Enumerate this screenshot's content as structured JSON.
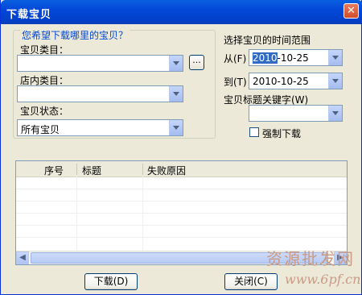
{
  "window": {
    "title": "下载宝贝"
  },
  "filter_group": {
    "legend": "您希望下载哪里的宝贝？",
    "category_label": "宝贝类目：",
    "category_value": "",
    "browse_label": "...",
    "shop_category_label": "店内类目：",
    "shop_category_value": "",
    "status_label": "宝贝状态：",
    "status_value": "所有宝贝"
  },
  "time_range": {
    "label": "选择宝贝的时间范围",
    "from_label": "从(F)",
    "from_year": "2010",
    "from_rest": "-10-25",
    "to_label": "到(T)",
    "to_value": "2010-10-25"
  },
  "keyword": {
    "label": "宝贝标题关键字(W)",
    "value": ""
  },
  "force_download": {
    "label": "强制下载",
    "checked": false
  },
  "results_table": {
    "columns": [
      "序号",
      "标题",
      "失败原因"
    ],
    "rows": []
  },
  "buttons": {
    "download": "下载(D)",
    "close": "关闭(C)"
  },
  "watermark": {
    "line1": "资源批发网",
    "line2": "www.6pf.cn"
  },
  "colors": {
    "title_bar": "#0348D8",
    "legend_text": "#0046D5",
    "selection": "#316AC5"
  }
}
